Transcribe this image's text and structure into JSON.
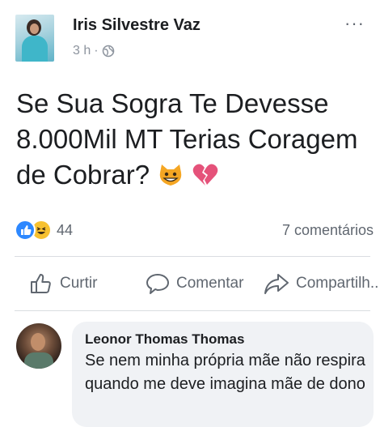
{
  "post": {
    "author": "Iris Silvestre Vaz",
    "time": "3 h",
    "separator": "·",
    "more": "···",
    "text": "Se Sua Sogra Te Devesse 8.000Mil MT Terias Coragem de Cobrar?",
    "emojis": [
      "grinning-cat",
      "broken-heart"
    ]
  },
  "stats": {
    "reaction_count": "44",
    "comments": "7 comentários"
  },
  "actions": {
    "like": "Curtir",
    "comment": "Comentar",
    "share": "Compartilh..."
  },
  "comment": {
    "author": "Leonor Thomas Thomas",
    "text": "Se nem minha própria mãe não respira quando me deve imagina mãe de dono"
  },
  "colors": {
    "like_blue": "#2d88ff",
    "haha_yellow": "#f7c130",
    "muted": "#606770",
    "bubble": "#f0f2f5"
  }
}
